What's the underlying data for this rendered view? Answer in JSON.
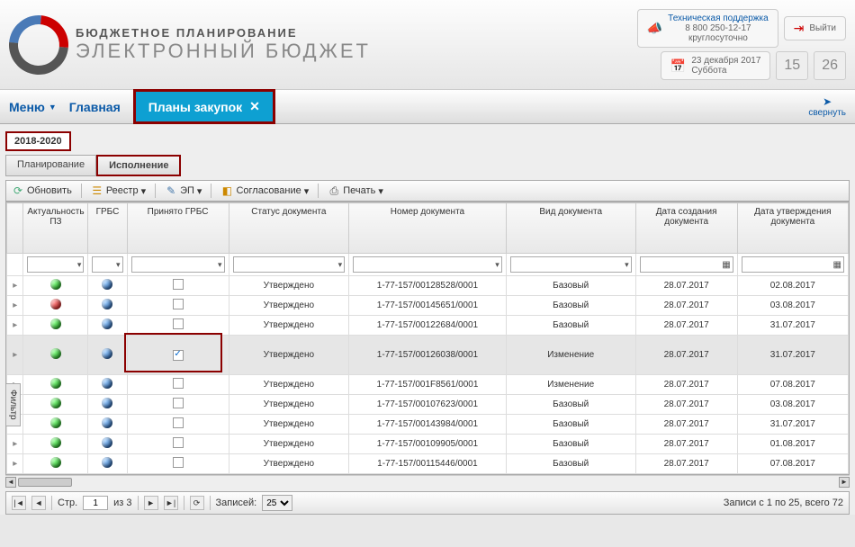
{
  "header": {
    "small": "БЮДЖЕТНОЕ ПЛАНИРОВАНИЕ",
    "big": "ЭЛЕКТРОННЫЙ БЮДЖЕТ",
    "support_label": "Техническая поддержка",
    "support_phone": "8 800 250-12-17",
    "support_hours": "круглосуточно",
    "exit": "Выйти",
    "date_line": "23 декабря 2017",
    "day_line": "Суббота",
    "hour": "15",
    "minute": "26"
  },
  "nav": {
    "menu": "Меню",
    "home": "Главная",
    "tab": "Планы закупок",
    "collapse": "свернуть"
  },
  "year_tab": "2018-2020",
  "subtabs": {
    "plan": "Планирование",
    "exec": "Исполнение"
  },
  "toolbar": {
    "refresh": "Обновить",
    "registry": "Реестр",
    "ep": "ЭП",
    "approval": "Согласование",
    "print": "Печать"
  },
  "filter_label": "Фильтр",
  "columns": {
    "actuality": "Актуальность ПЗ",
    "grbs": "ГРБС",
    "accepted": "Принято ГРБС",
    "status": "Статус документа",
    "number": "Номер документа",
    "kind": "Вид документа",
    "created": "Дата создания документа",
    "approved": "Дата утверждения документа"
  },
  "status_val": "Утверждено",
  "kinds": {
    "base": "Базовый",
    "change": "Изменение"
  },
  "rows": [
    {
      "act": "green",
      "grbs": "blue",
      "chk": false,
      "num": "1-77-157/00128528/0001",
      "kind": "base",
      "dc": "28.07.2017",
      "du": "02.08.2017",
      "sel": false
    },
    {
      "act": "red",
      "grbs": "blue",
      "chk": false,
      "num": "1-77-157/00145651/0001",
      "kind": "base",
      "dc": "28.07.2017",
      "du": "03.08.2017",
      "sel": false
    },
    {
      "act": "green",
      "grbs": "blue",
      "chk": false,
      "num": "1-77-157/00122684/0001",
      "kind": "base",
      "dc": "28.07.2017",
      "du": "31.07.2017",
      "sel": false
    },
    {
      "act": "green",
      "grbs": "blue",
      "chk": true,
      "num": "1-77-157/00126038/0001",
      "kind": "change",
      "dc": "28.07.2017",
      "du": "31.07.2017",
      "sel": true
    },
    {
      "act": "green",
      "grbs": "blue",
      "chk": false,
      "num": "1-77-157/001F8561/0001",
      "kind": "change",
      "dc": "28.07.2017",
      "du": "07.08.2017",
      "sel": false
    },
    {
      "act": "green",
      "grbs": "blue",
      "chk": false,
      "num": "1-77-157/00107623/0001",
      "kind": "base",
      "dc": "28.07.2017",
      "du": "03.08.2017",
      "sel": false
    },
    {
      "act": "green",
      "grbs": "blue",
      "chk": false,
      "num": "1-77-157/00143984/0001",
      "kind": "base",
      "dc": "28.07.2017",
      "du": "31.07.2017",
      "sel": false
    },
    {
      "act": "green",
      "grbs": "blue",
      "chk": false,
      "num": "1-77-157/00109905/0001",
      "kind": "base",
      "dc": "28.07.2017",
      "du": "01.08.2017",
      "sel": false
    },
    {
      "act": "green",
      "grbs": "blue",
      "chk": false,
      "num": "1-77-157/00115446/0001",
      "kind": "base",
      "dc": "28.07.2017",
      "du": "07.08.2017",
      "sel": false
    }
  ],
  "pager": {
    "page_label": "Стр.",
    "page": "1",
    "of": "из 3",
    "records_label": "Записей:",
    "records": "25",
    "summary": "Записи с 1 по 25, всего 72"
  }
}
